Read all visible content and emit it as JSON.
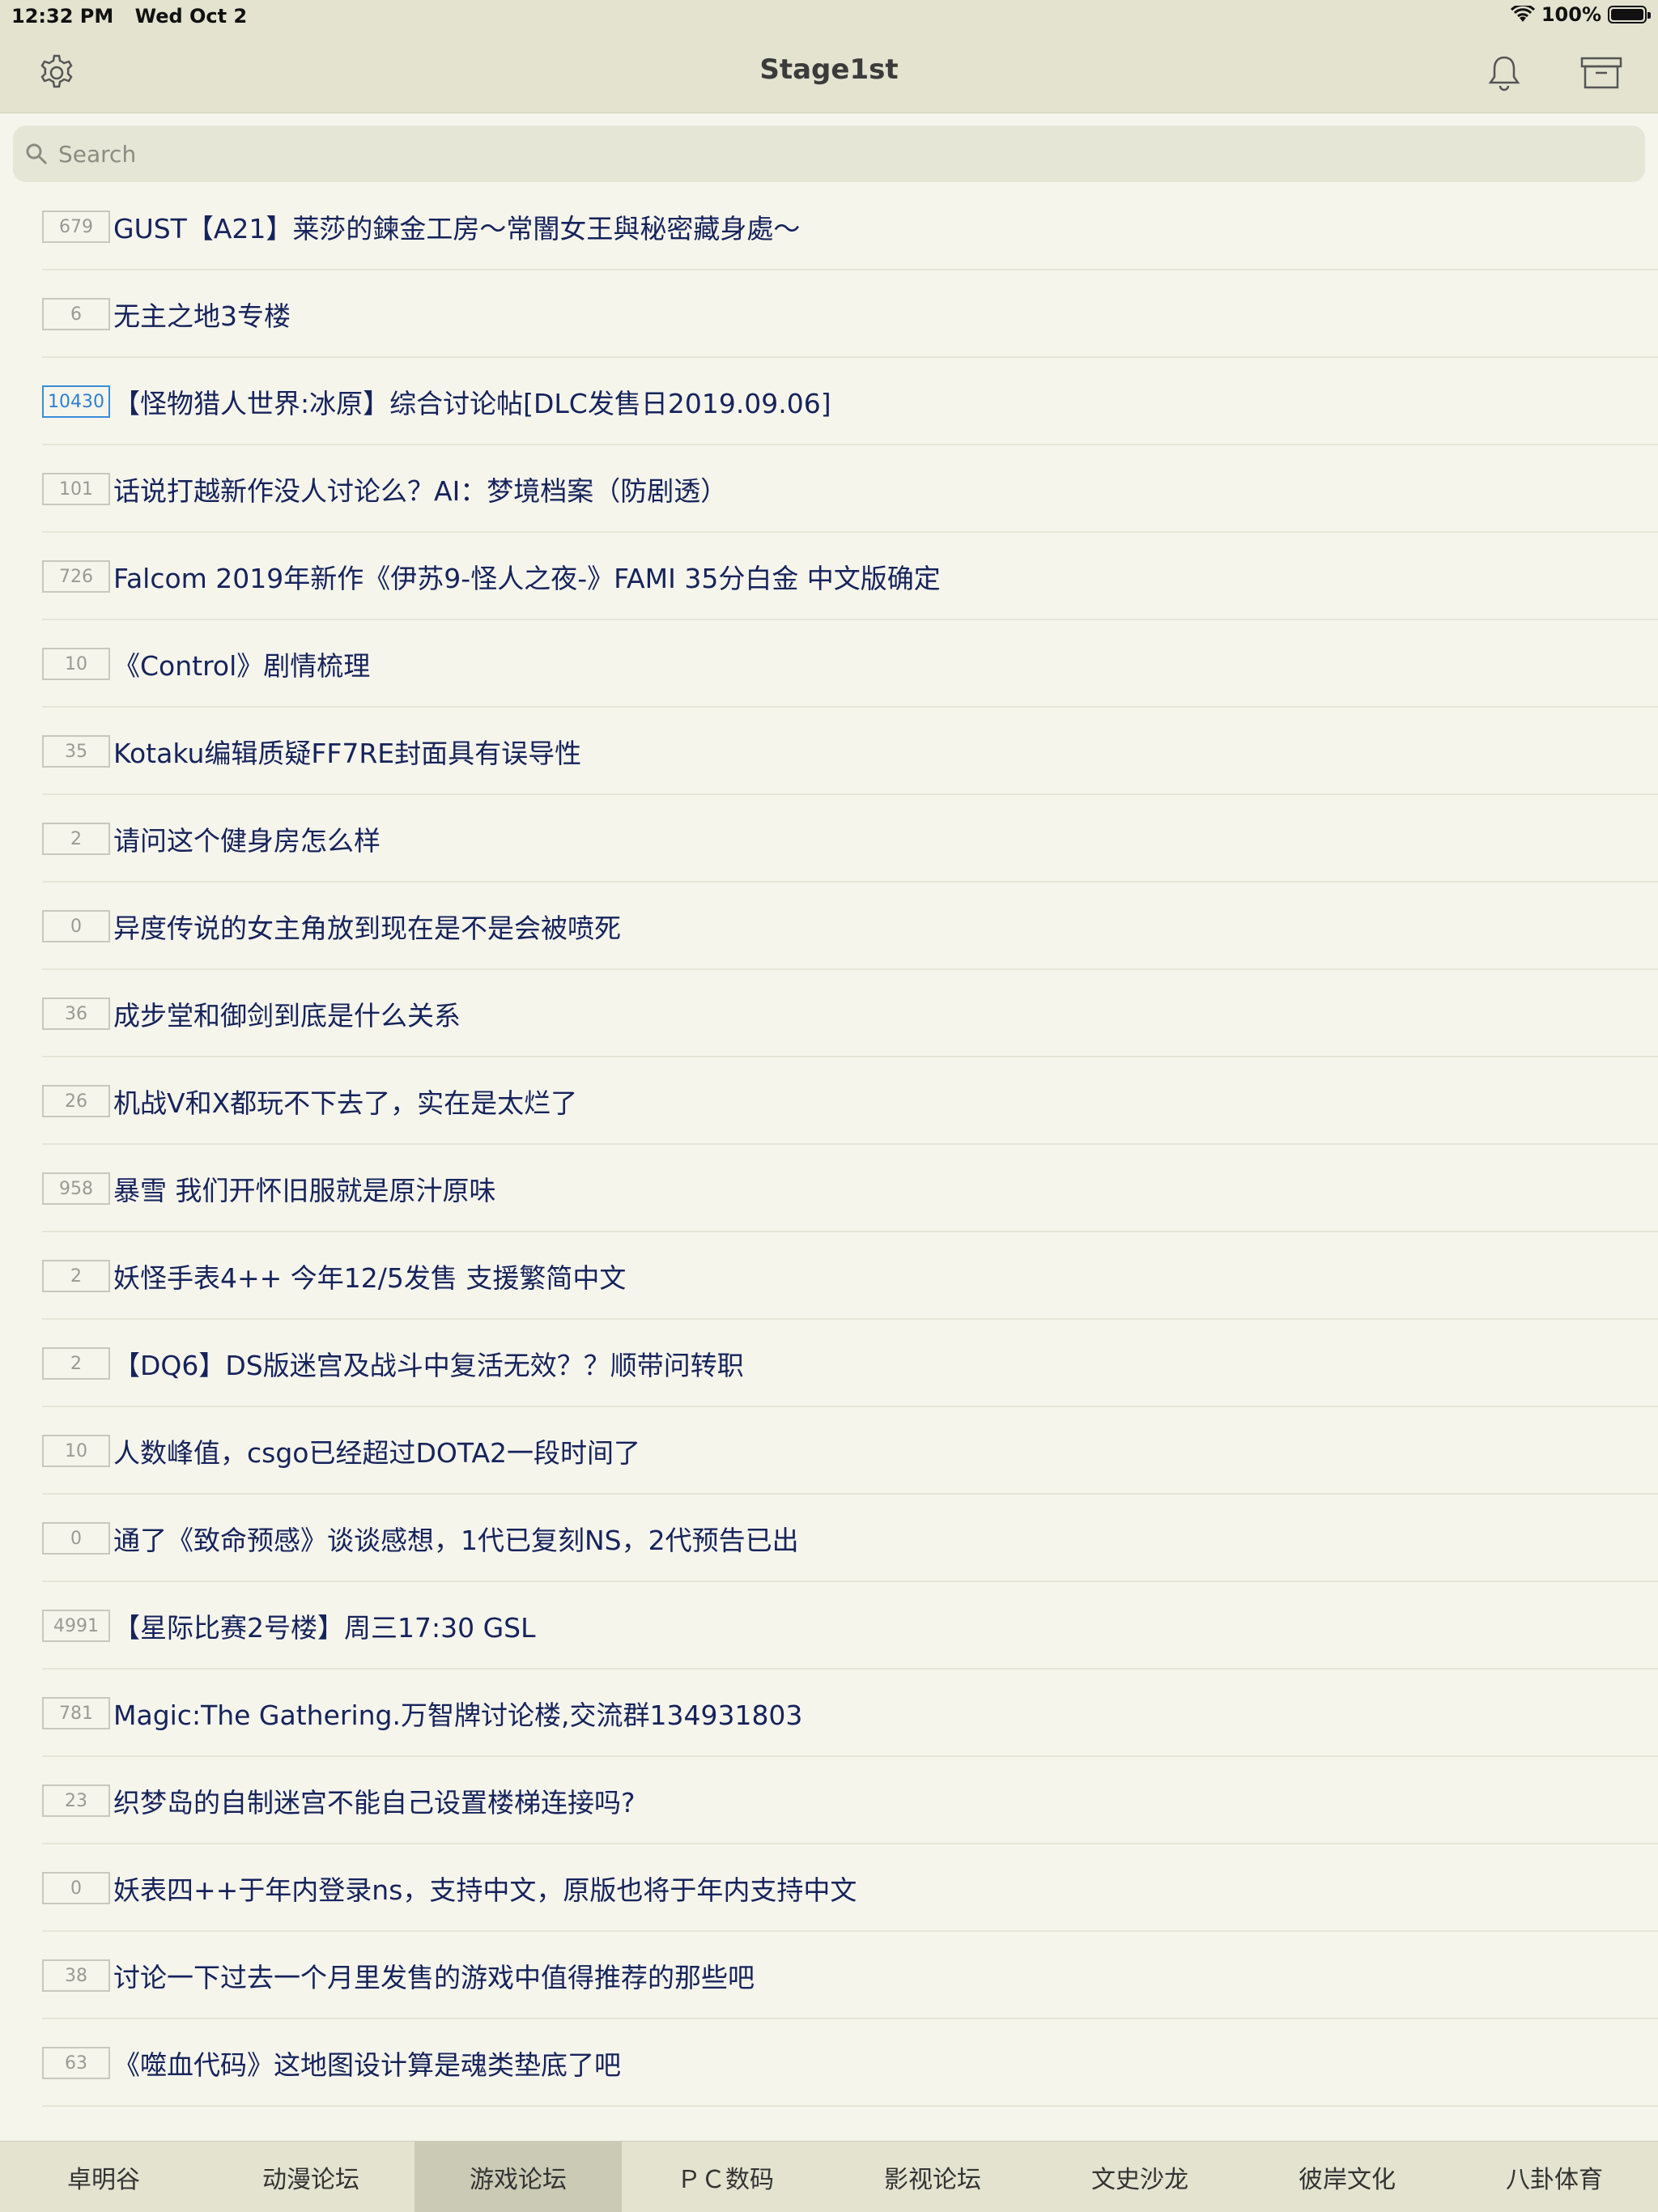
{
  "status_bar": {
    "time": "12:32 PM",
    "date": "Wed Oct 2",
    "battery": "100%"
  },
  "nav": {
    "title": "Stage1st"
  },
  "search": {
    "placeholder": "Search"
  },
  "threads": [
    {
      "count": "679",
      "title": "GUST【A21】莱莎的鍊金工房～常闇女王與秘密藏身處～",
      "hot": false
    },
    {
      "count": "6",
      "title": "无主之地3专楼",
      "hot": false
    },
    {
      "count": "10430",
      "title": "【怪物猎人世界:冰原】综合讨论帖[DLC发售日2019.09.06]",
      "hot": true
    },
    {
      "count": "101",
      "title": "话说打越新作没人讨论么？AI：梦境档案（防剧透）",
      "hot": false
    },
    {
      "count": "726",
      "title": "Falcom 2019年新作《伊苏9-怪人之夜-》FAMI 35分白金 中文版确定",
      "hot": false
    },
    {
      "count": "10",
      "title": "《Control》剧情梳理",
      "hot": false
    },
    {
      "count": "35",
      "title": "Kotaku编辑质疑FF7RE封面具有误导性",
      "hot": false
    },
    {
      "count": "2",
      "title": "请问这个健身房怎么样",
      "hot": false
    },
    {
      "count": "0",
      "title": "异度传说的女主角放到现在是不是会被喷死",
      "hot": false
    },
    {
      "count": "36",
      "title": "成步堂和御剑到底是什么关系",
      "hot": false
    },
    {
      "count": "26",
      "title": "机战V和X都玩不下去了，实在是太烂了",
      "hot": false
    },
    {
      "count": "958",
      "title": "暴雪 我们开怀旧服就是原汁原味",
      "hot": false
    },
    {
      "count": "2",
      "title": "妖怪手表4++ 今年12/5发售 支援繁简中文",
      "hot": false
    },
    {
      "count": "2",
      "title": "【DQ6】DS版迷宫及战斗中复活无效？？顺带问转职",
      "hot": false
    },
    {
      "count": "10",
      "title": "人数峰值，csgo已经超过DOTA2一段时间了",
      "hot": false
    },
    {
      "count": "0",
      "title": "通了《致命预感》谈谈感想，1代已复刻NS，2代预告已出",
      "hot": false
    },
    {
      "count": "4991",
      "title": "【星际比赛2号楼】周三17:30 GSL",
      "hot": false
    },
    {
      "count": "781",
      "title": "Magic:The Gathering.万智牌讨论楼,交流群134931803",
      "hot": false
    },
    {
      "count": "23",
      "title": "织梦岛的自制迷宫不能自己设置楼梯连接吗?",
      "hot": false
    },
    {
      "count": "0",
      "title": "妖表四++于年内登录ns，支持中文，原版也将于年内支持中文",
      "hot": false
    },
    {
      "count": "38",
      "title": "讨论一下过去一个月里发售的游戏中值得推荐的那些吧",
      "hot": false
    },
    {
      "count": "63",
      "title": "《噬血代码》这地图设计算是魂类垫底了吧",
      "hot": false
    }
  ],
  "tabs": [
    {
      "label": "卓明谷",
      "active": false
    },
    {
      "label": "动漫论坛",
      "active": false
    },
    {
      "label": "游戏论坛",
      "active": true
    },
    {
      "label": "ＰＣ数码",
      "active": false
    },
    {
      "label": "影视论坛",
      "active": false
    },
    {
      "label": "文史沙龙",
      "active": false
    },
    {
      "label": "彼岸文化",
      "active": false
    },
    {
      "label": "八卦体育",
      "active": false
    }
  ],
  "icons": {
    "settings": "gear-icon",
    "notifications": "bell-icon",
    "archive": "archive-box-icon",
    "search": "magnifier-icon",
    "wifi": "wifi-icon",
    "battery": "battery-icon"
  },
  "colors": {
    "bar_bg": "#e3e3d0",
    "page_bg": "#f6f5ec",
    "title_text": "#16235b",
    "badge_hot": "#2f7fd0",
    "active_tab": "#cacab5"
  }
}
